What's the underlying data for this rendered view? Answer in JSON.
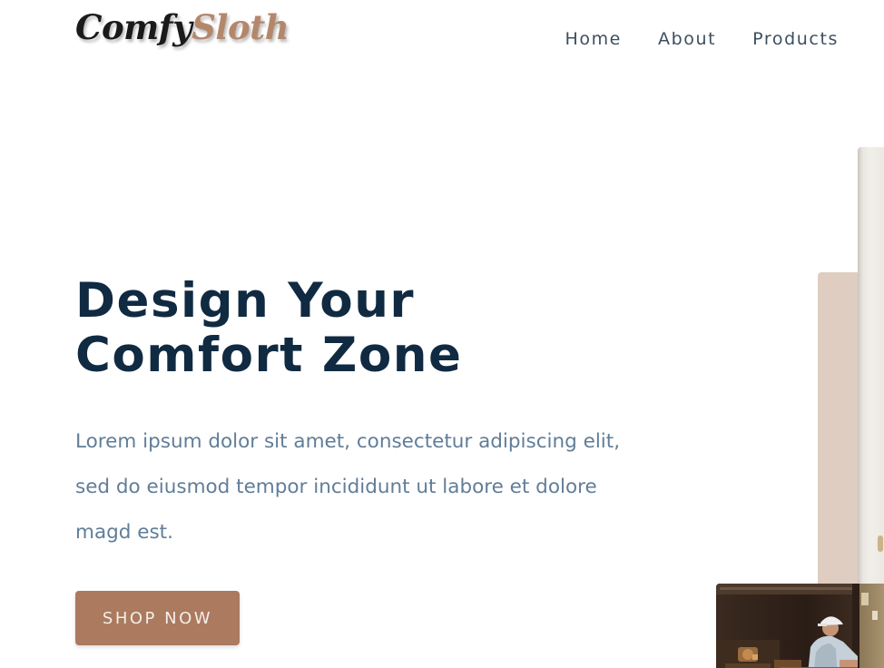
{
  "navbar": {
    "logo": {
      "part1": "Comfy",
      "part2": "Sloth"
    },
    "links": [
      {
        "label": "Home"
      },
      {
        "label": "About"
      },
      {
        "label": "Products"
      }
    ]
  },
  "hero": {
    "title_lines": [
      "Design Your",
      "Comfort Zone"
    ],
    "text_lines": [
      "Lorem ipsum dolor sit amet, consectetur adipiscing elit,",
      "sed do eiusmod tempor incididunt ut labore et dolore",
      "magd est."
    ],
    "cta_label": "SHOP NOW"
  },
  "colors": {
    "primary": "#ab7a5f",
    "heading": "#102a42",
    "body_text": "#617d98",
    "accent_light": "#dfcdc1"
  }
}
